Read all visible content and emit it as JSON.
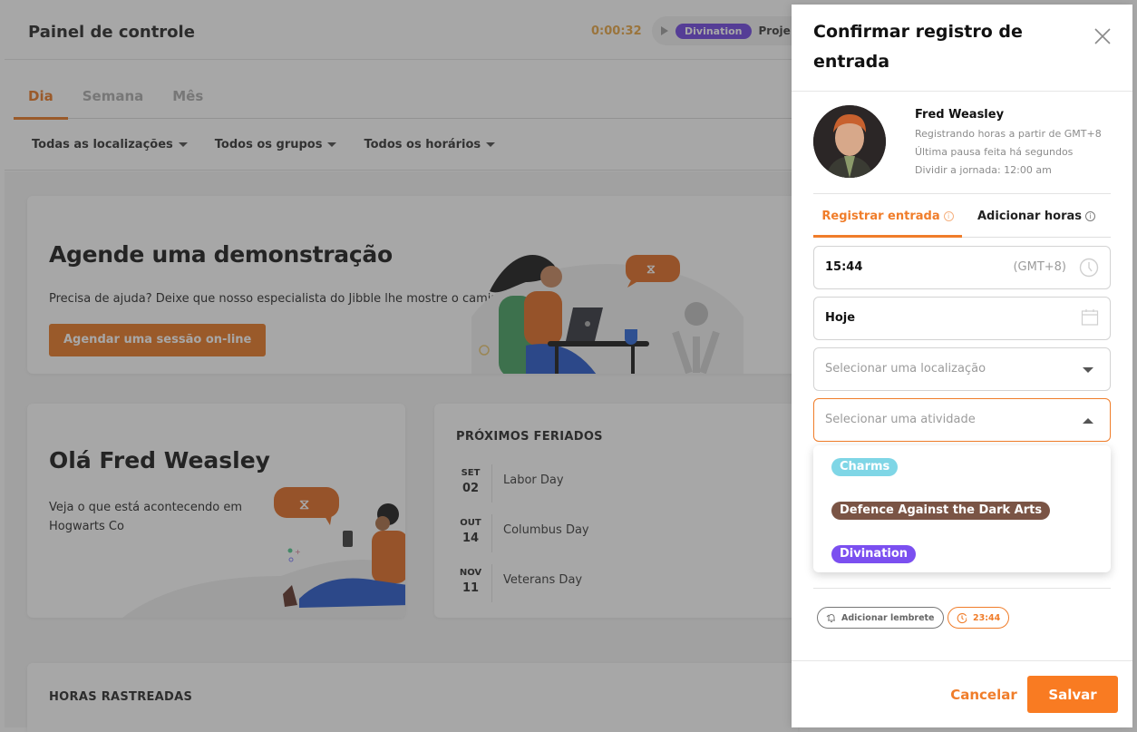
{
  "header": {
    "title": "Painel de controle",
    "timer": "0:00:32",
    "current_activity": "Divination",
    "current_project_partial": "Proje"
  },
  "tabs": [
    {
      "label": "Dia",
      "active": true
    },
    {
      "label": "Semana",
      "active": false
    },
    {
      "label": "Mês",
      "active": false
    }
  ],
  "filters": [
    {
      "label": "Todas as localizações"
    },
    {
      "label": "Todos os grupos"
    },
    {
      "label": "Todos os horários"
    }
  ],
  "demo_card": {
    "title": "Agende uma demonstração",
    "text": "Precisa de ajuda? Deixe que nosso especialista do Jibble lhe mostre o caminho.",
    "button_label": "Agendar uma sessão on-line"
  },
  "hello_card": {
    "title": "Olá Fred Weasley",
    "text": "Veja o que está acontecendo em Hogwarts Co"
  },
  "holidays_card": {
    "title": "PRÓXIMOS FERIADOS",
    "items": [
      {
        "month": "SET",
        "day": "02",
        "name": "Labor Day"
      },
      {
        "month": "OUT",
        "day": "14",
        "name": "Columbus Day"
      },
      {
        "month": "NOV",
        "day": "11",
        "name": "Veterans Day"
      }
    ]
  },
  "hours_card": {
    "title": "HORAS RASTREADAS"
  },
  "panel": {
    "title": "Confirmar registro de entrada",
    "user": {
      "name": "Fred Weasley",
      "lines": [
        "Registrando horas a partir de GMT+8",
        "Última pausa feita há segundos",
        "Dividir a jornada: 12:00 am"
      ]
    },
    "tabs": [
      {
        "label": "Registrar entrada",
        "active": true
      },
      {
        "label": "Adicionar horas",
        "active": false
      }
    ],
    "time_field": {
      "value": "15:44",
      "timezone": "(GMT+8)"
    },
    "date_field": {
      "value": "Hoje"
    },
    "location_field": {
      "placeholder": "Selecionar uma localização"
    },
    "activity_field": {
      "placeholder": "Selecionar uma atividade",
      "open": true
    },
    "activity_options": [
      {
        "label": "Charms",
        "color": "#7fd6e6"
      },
      {
        "label": "Defence Against the Dark Arts",
        "color": "#7a5445"
      },
      {
        "label": "Divination",
        "color": "#7b4ff0"
      }
    ],
    "reminder_label": "Adicionar lembrete",
    "auto_clockout_time": "23:44",
    "cancel_label": "Cancelar",
    "save_label": "Salvar"
  },
  "colors": {
    "accent": "#f07d2a",
    "divination": "#6a3fe0"
  }
}
